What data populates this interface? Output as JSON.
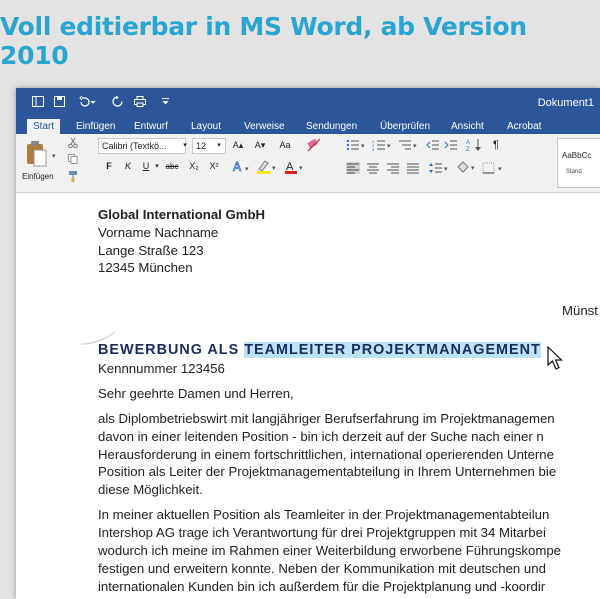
{
  "banner": {
    "text": "Voll editierbar in MS Word, ab Version 2010"
  },
  "titlebar": {
    "doc_title": "Dokument1",
    "icons": [
      "sidebar-icon",
      "save-icon",
      "undo-icon",
      "redo-icon",
      "print-icon",
      "customize-icon"
    ]
  },
  "tabs": [
    "Start",
    "Einfügen",
    "Entwurf",
    "Layout",
    "Verweise",
    "Sendungen",
    "Überprüfen",
    "Ansicht",
    "Acrobat"
  ],
  "ribbon": {
    "paste_label": "Einfügen",
    "font_name": "Calibri (Textkö...",
    "font_size": "12",
    "grow": "A▴",
    "shrink": "A▾",
    "case": "Aa",
    "bold": "F",
    "italic": "K",
    "underline": "U",
    "strike": "abc",
    "sub": "X₂",
    "sup": "X²",
    "style_sample": "AaBbCc",
    "style_name": "Stand"
  },
  "document": {
    "address": [
      "Global International GmbH",
      "Vorname Nachname",
      "Lange Straße 123",
      "12345 München"
    ],
    "place": "Münst",
    "heading_prefix": "BEWERBUNG ALS ",
    "heading_selected": "TEAMLEITER PROJEKTMANAGEMENT",
    "reference": "Kennnummer 123456",
    "salutation": "Sehr geehrte Damen und Herren,",
    "paragraph1": [
      "als Diplombetriebswirt mit langjähriger Berufserfahrung im Projektmanagemen",
      "davon in einer leitenden Position - bin ich derzeit auf der Suche nach einer n",
      "Herausforderung in einem fortschrittlichen, international operierenden Unterne",
      "Position als Leiter der Projektmanagementabteilung in Ihrem Unternehmen bie",
      "diese Möglichkeit."
    ],
    "paragraph2": [
      "In meiner aktuellen Position als Teamleiter in der Projektmanagementabteilun",
      "Intershop AG trage ich Verantwortung für drei Projektgruppen mit 34 Mitarbei",
      "wodurch ich meine im Rahmen einer Weiterbildung erworbene Führungskompe",
      "festigen und erweitern konnte. Neben der Kommunikation mit deutschen und",
      "internationalen Kunden bin ich außerdem für die Projektplanung und -koordir"
    ]
  }
}
